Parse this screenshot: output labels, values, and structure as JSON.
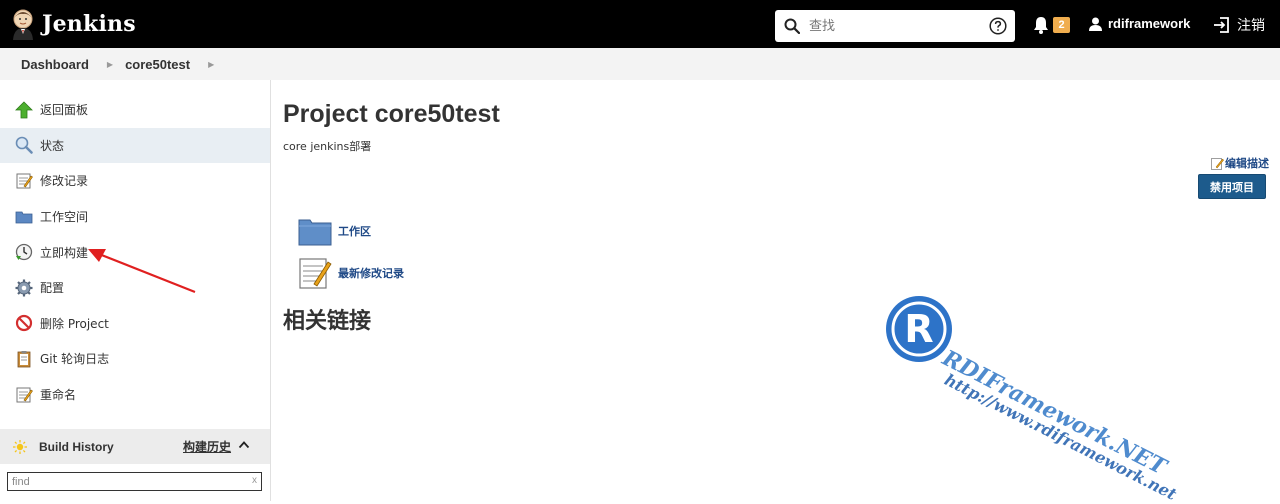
{
  "header": {
    "logo_text": "Jenkins",
    "search_placeholder": "查找",
    "notification_count": "2",
    "username": "rdiframework",
    "logout_label": "注销"
  },
  "breadcrumb": [
    "Dashboard",
    "core50test"
  ],
  "sidebar": {
    "items": [
      {
        "label": "返回面板",
        "icon": "up-arrow-icon"
      },
      {
        "label": "状态",
        "icon": "magnifier-icon"
      },
      {
        "label": "修改记录",
        "icon": "notepad-icon"
      },
      {
        "label": "工作空间",
        "icon": "folder-icon"
      },
      {
        "label": "立即构建",
        "icon": "build-clock-icon"
      },
      {
        "label": "配置",
        "icon": "gear-icon"
      },
      {
        "label": "删除 Project",
        "icon": "no-entry-icon"
      },
      {
        "label": "Git 轮询日志",
        "icon": "clipboard-icon"
      },
      {
        "label": "重命名",
        "icon": "notepad-icon"
      }
    ],
    "active_index": 1
  },
  "build_history": {
    "title": "Build History",
    "trend_link": "构建历史",
    "find_placeholder": "find",
    "clear_symbol": "x"
  },
  "main": {
    "title": "Project core50test",
    "description": "core jenkins部署",
    "edit_description": "编辑描述",
    "disable_button": "禁用项目",
    "links": [
      {
        "label": "工作区",
        "icon": "folder-icon"
      },
      {
        "label": "最新修改记录",
        "icon": "notepad-icon"
      }
    ],
    "related_links_heading": "相关链接"
  },
  "watermark": {
    "logo_letter": "R",
    "line1": "RDIFramework.NET",
    "line2": "http://www.rdiframework.net"
  },
  "colors": {
    "header_bg": "#000000",
    "badge": "#f0ad4e",
    "link": "#204a87",
    "button": "#1d5b8c",
    "annotation_arrow": "#e02020"
  }
}
